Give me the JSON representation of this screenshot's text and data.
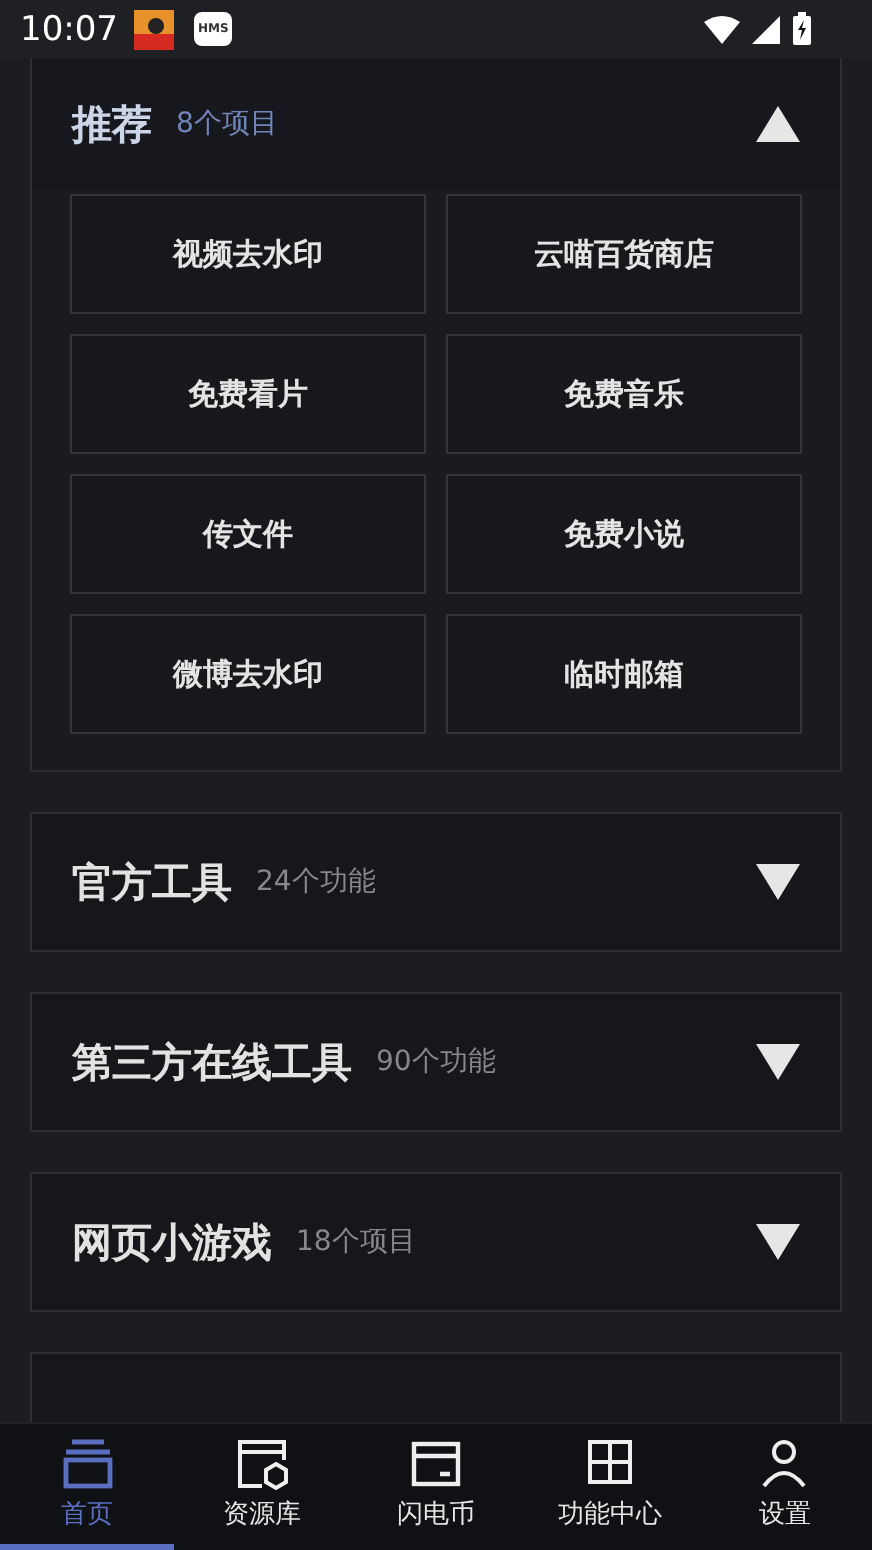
{
  "status_bar": {
    "time": "10:07",
    "badge": "HMS"
  },
  "sections": [
    {
      "title": "推荐",
      "count": "8个项目",
      "expanded": true,
      "items": [
        "视频去水印",
        "云喵百货商店",
        "免费看片",
        "免费音乐",
        "传文件",
        "免费小说",
        "微博去水印",
        "临时邮箱"
      ]
    },
    {
      "title": "官方工具",
      "count": "24个功能",
      "expanded": false
    },
    {
      "title": "第三方在线工具",
      "count": "90个功能",
      "expanded": false
    },
    {
      "title": "网页小游戏",
      "count": "18个项目",
      "expanded": false
    }
  ],
  "nav": [
    {
      "kind": "home",
      "label": "首页",
      "selected": true
    },
    {
      "kind": "library",
      "label": "资源库",
      "selected": false
    },
    {
      "kind": "coin",
      "label": "闪电币",
      "selected": false
    },
    {
      "kind": "grid",
      "label": "功能中心",
      "selected": false
    },
    {
      "kind": "settings",
      "label": "设置",
      "selected": false
    }
  ]
}
